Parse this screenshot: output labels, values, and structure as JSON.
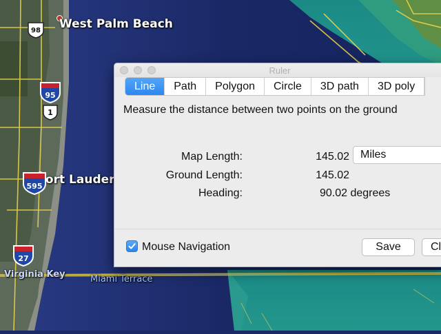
{
  "map": {
    "labels": {
      "west_palm_beach": "West Palm Beach",
      "fort_lauderdale": "Fort Lauderd",
      "virginia_key": "Virginia Key",
      "miami_terrace": "Miami Terrace"
    },
    "shields": {
      "us_98": "98",
      "i_95": "95",
      "us_1": "1",
      "i_595": "595",
      "i_27": "27"
    }
  },
  "ruler": {
    "title": "Ruler",
    "tabs": [
      "Line",
      "Path",
      "Polygon",
      "Circle",
      "3D path",
      "3D poly"
    ],
    "active_tab": "Line",
    "description": "Measure the distance between two points on the ground",
    "map_length_label": "Map Length:",
    "map_length_value": "145.02",
    "unit": "Miles",
    "ground_length_label": "Ground Length:",
    "ground_length_value": "145.02",
    "heading_label": "Heading:",
    "heading_value": "90.02 degrees",
    "mouse_navigation_label": "Mouse Navigation",
    "mouse_navigation_checked": true,
    "save_label": "Save",
    "clear_label": "Cl"
  }
}
